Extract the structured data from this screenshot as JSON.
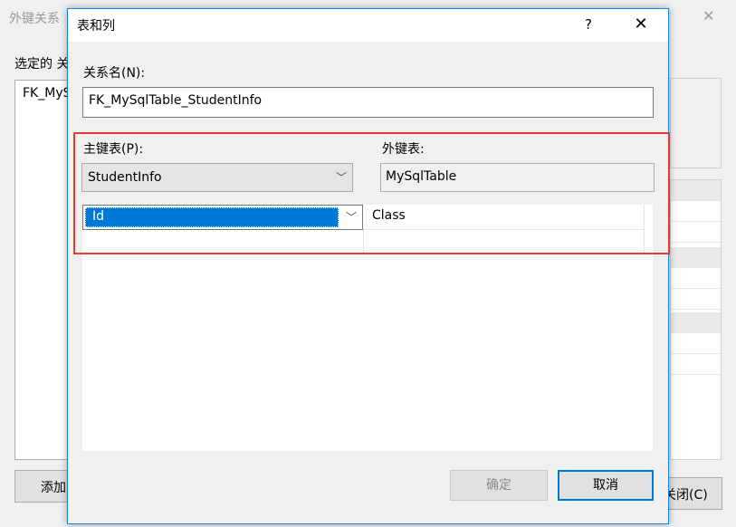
{
  "background_window": {
    "title": "外键关系",
    "close_glyph": "✕",
    "selected_label": "选定的 关",
    "list_item": "FK_MySqlTable_StudentInfo",
    "add_button": "添加(A)",
    "close_button": "关闭(C)"
  },
  "dialog": {
    "title": "表和列",
    "help_glyph": "?",
    "close_glyph": "✕",
    "relationship_name_label": "关系名(N):",
    "relationship_name_value": "FK_MySqlTable_StudentInfo",
    "primary_table_label": "主键表(P):",
    "primary_table_value": "StudentInfo",
    "foreign_table_label": "外键表:",
    "foreign_table_value": "MySqlTable",
    "columns": [
      {
        "primary": "Id",
        "foreign": "Class"
      }
    ],
    "ok_button": "确定",
    "cancel_button": "取消"
  },
  "colors": {
    "highlight_border": "#e53935",
    "selection": "#0078d7",
    "dialog_border": "#1883d7"
  },
  "icons": {
    "dropdown": "chevron-down-icon",
    "help": "help-icon",
    "close": "close-icon"
  }
}
